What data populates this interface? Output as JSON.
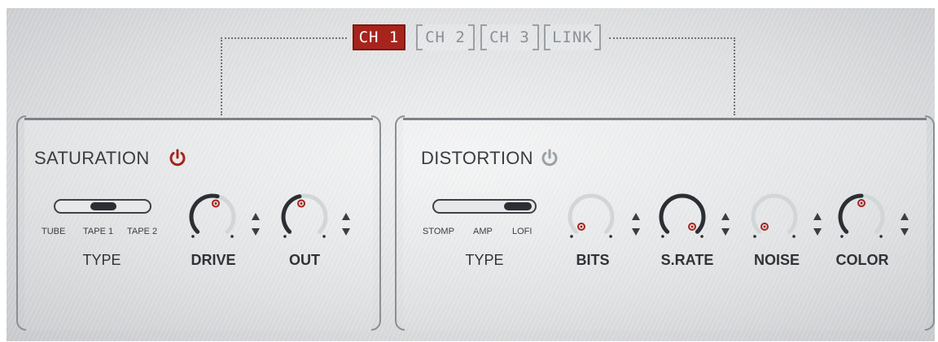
{
  "tabs": [
    {
      "label": "CH 1",
      "active": true
    },
    {
      "label": "CH 2",
      "active": false
    },
    {
      "label": "CH 3",
      "active": false
    },
    {
      "label": "LINK",
      "active": false
    }
  ],
  "saturation": {
    "title": "SATURATION",
    "power_on": true,
    "type_options": [
      "TUBE",
      "TAPE 1",
      "TAPE 2"
    ],
    "type_selected": "TAPE 1",
    "type_label": "TYPE",
    "knobs": [
      {
        "label": "DRIVE",
        "value": 0.55
      },
      {
        "label": "OUT",
        "value": 0.45
      }
    ]
  },
  "distortion": {
    "title": "DISTORTION",
    "power_on": false,
    "type_options": [
      "STOMP",
      "AMP",
      "LOFI"
    ],
    "type_selected": "LOFI",
    "type_label": "TYPE",
    "knobs": [
      {
        "label": "BITS",
        "value": 0.0
      },
      {
        "label": "S.RATE",
        "value": 1.0
      },
      {
        "label": "NOISE",
        "value": 0.0
      },
      {
        "label": "COLOR",
        "value": 0.5
      }
    ]
  },
  "colors": {
    "accent_red": "#a7241c",
    "power_off": "#9aa0a6",
    "knob_track": "#d3d6d9",
    "knob_arc": "#2b2e33"
  },
  "icons": {
    "power": "power-icon",
    "stepper": "up-down-arrows-icon"
  }
}
